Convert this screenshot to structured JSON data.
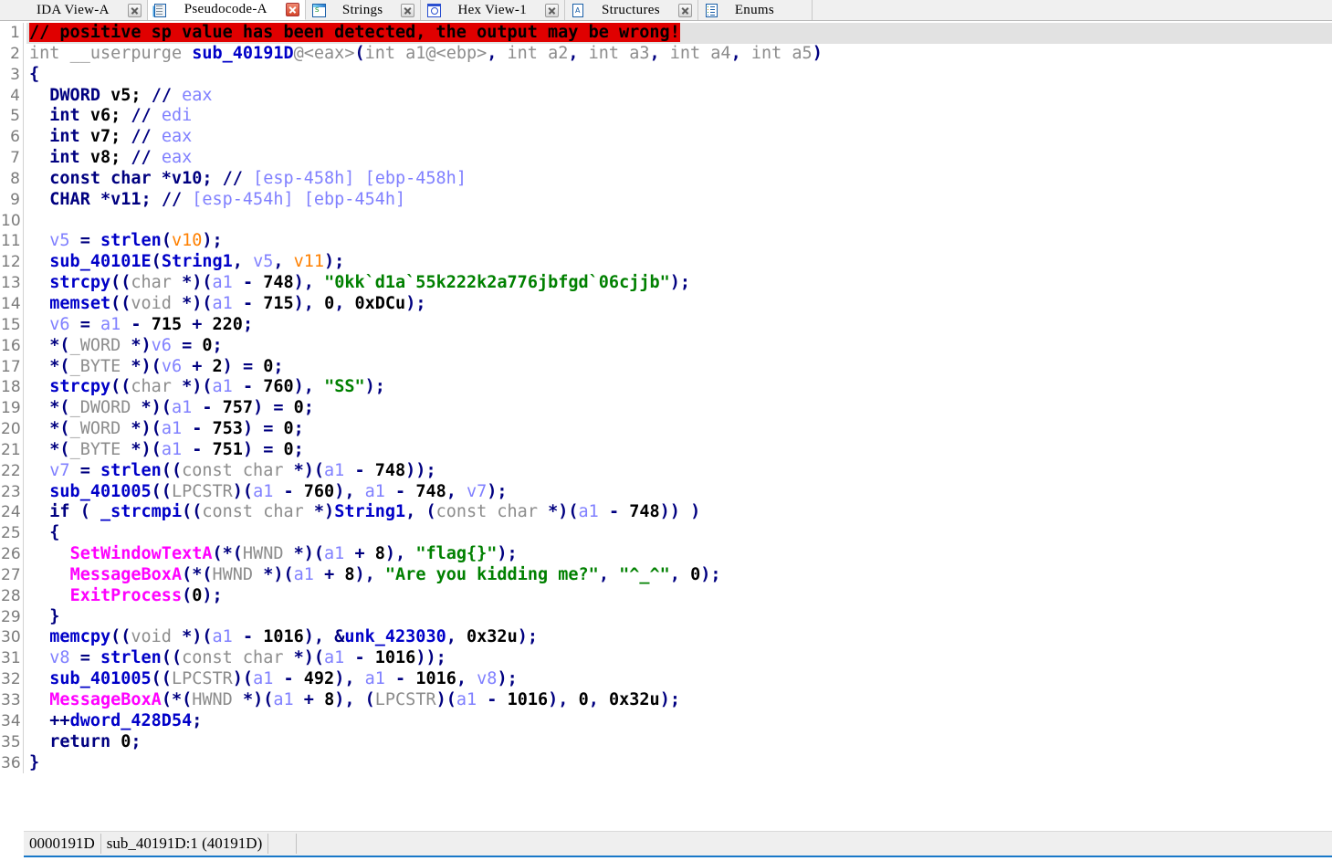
{
  "window": {
    "title": "IDA View / Pseudocode"
  },
  "tabs": [
    {
      "label": "IDA View-A",
      "icon": "ida-view-icon",
      "closable": true,
      "close_style": "gray",
      "active": false,
      "has_icon": false
    },
    {
      "label": "Pseudocode-A",
      "icon": "pseudocode-icon",
      "closable": true,
      "close_style": "red",
      "active": true,
      "has_icon": true
    },
    {
      "label": "Strings",
      "icon": "strings-icon",
      "closable": true,
      "close_style": "gray",
      "active": false,
      "has_icon": true
    },
    {
      "label": "Hex View-1",
      "icon": "hex-view-icon",
      "closable": true,
      "close_style": "gray",
      "active": false,
      "has_icon": true
    },
    {
      "label": "Structures",
      "icon": "structures-icon",
      "closable": true,
      "close_style": "gray",
      "active": false,
      "has_icon": true
    },
    {
      "label": "Enums",
      "icon": "enums-icon",
      "closable": false,
      "close_style": "gray",
      "active": false,
      "has_icon": true
    }
  ],
  "code": {
    "language": "c-pseudocode",
    "selected_line": 1,
    "lines": [
      {
        "n": 1,
        "html": "<span class=\"t-warn\">// positive sp value has been detected, the output may be wrong!</span>"
      },
      {
        "n": 2,
        "html": "<span class=\"t-type\">int</span> <span class=\"t-type\">__userpurge</span> <span class=\"t-fn\">sub_40191D</span><span class=\"t-type\">@&lt;eax&gt;</span><span class=\"t-punc\">(</span><span class=\"t-type\">int a1@&lt;ebp&gt;</span><span class=\"t-punc\">,</span><span class=\"t-type\"> int a2</span><span class=\"t-punc\">,</span><span class=\"t-type\"> int a3</span><span class=\"t-punc\">,</span><span class=\"t-type\"> int a4</span><span class=\"t-punc\">,</span><span class=\"t-type\"> int a5</span><span class=\"t-punc\">)</span>"
      },
      {
        "n": 3,
        "html": "<span class=\"t-punc\">{</span>"
      },
      {
        "n": 4,
        "html": "  <span class=\"t-kw\">DWORD</span> <span class=\"t-plain\">v5;</span> <span class=\"t-kw\">//</span> <span class=\"t-var\">eax</span>"
      },
      {
        "n": 5,
        "html": "  <span class=\"t-kw\">int</span> <span class=\"t-plain\">v6;</span> <span class=\"t-kw\">//</span> <span class=\"t-var\">edi</span>"
      },
      {
        "n": 6,
        "html": "  <span class=\"t-kw\">int</span> <span class=\"t-plain\">v7;</span> <span class=\"t-kw\">//</span> <span class=\"t-var\">eax</span>"
      },
      {
        "n": 7,
        "html": "  <span class=\"t-kw\">int</span> <span class=\"t-plain\">v8;</span> <span class=\"t-kw\">//</span> <span class=\"t-var\">eax</span>"
      },
      {
        "n": 8,
        "html": "  <span class=\"t-kw\">const char *v10;</span> <span class=\"t-kw\">//</span> <span class=\"t-var\">[esp-458h] [ebp-458h]</span>"
      },
      {
        "n": 9,
        "html": "  <span class=\"t-kw\">CHAR *v11;</span> <span class=\"t-kw\">//</span> <span class=\"t-var\">[esp-454h] [ebp-454h]</span>"
      },
      {
        "n": 10,
        "html": ""
      },
      {
        "n": 11,
        "html": "  <span class=\"t-var\">v5</span> <span class=\"t-punc\">=</span> <span class=\"t-fn\">strlen</span><span class=\"t-punc\">(</span><span class=\"t-var2\">v10</span><span class=\"t-punc\">);</span>"
      },
      {
        "n": 12,
        "html": "  <span class=\"t-fn\">sub_40101E</span><span class=\"t-punc\">(</span><span class=\"t-fn\">String1</span><span class=\"t-punc\">,</span> <span class=\"t-var\">v5</span><span class=\"t-punc\">,</span> <span class=\"t-var2\">v11</span><span class=\"t-punc\">);</span>"
      },
      {
        "n": 13,
        "html": "  <span class=\"t-fn\">strcpy</span><span class=\"t-punc\">((</span><span class=\"t-gray\">char </span><span class=\"t-punc\">*)(</span><span class=\"t-var\">a1</span> <span class=\"t-punc\">-</span> <span class=\"t-num\">748</span><span class=\"t-punc\">),</span> <span class=\"t-str\">\"0kk`d1a`55k222k2a776jbfgd`06cjjb\"</span><span class=\"t-punc\">);</span>"
      },
      {
        "n": 14,
        "html": "  <span class=\"t-fn\">memset</span><span class=\"t-punc\">((</span><span class=\"t-gray\">void </span><span class=\"t-punc\">*)(</span><span class=\"t-var\">a1</span> <span class=\"t-punc\">-</span> <span class=\"t-num\">715</span><span class=\"t-punc\">),</span> <span class=\"t-num\">0</span><span class=\"t-punc\">,</span> <span class=\"t-num\">0xDCu</span><span class=\"t-punc\">);</span>"
      },
      {
        "n": 15,
        "html": "  <span class=\"t-var\">v6</span> <span class=\"t-punc\">=</span> <span class=\"t-var\">a1</span> <span class=\"t-punc\">-</span> <span class=\"t-num\">715</span> <span class=\"t-punc\">+</span> <span class=\"t-num\">220</span><span class=\"t-punc\">;</span>"
      },
      {
        "n": 16,
        "html": "  <span class=\"t-punc\">*(</span><span class=\"t-gray\">_WORD </span><span class=\"t-punc\">*)</span><span class=\"t-var\">v6</span> <span class=\"t-punc\">=</span> <span class=\"t-num\">0</span><span class=\"t-punc\">;</span>"
      },
      {
        "n": 17,
        "html": "  <span class=\"t-punc\">*(</span><span class=\"t-gray\">_BYTE </span><span class=\"t-punc\">*)(</span><span class=\"t-var\">v6</span> <span class=\"t-punc\">+</span> <span class=\"t-num\">2</span><span class=\"t-punc\">)</span> <span class=\"t-punc\">=</span> <span class=\"t-num\">0</span><span class=\"t-punc\">;</span>"
      },
      {
        "n": 18,
        "html": "  <span class=\"t-fn\">strcpy</span><span class=\"t-punc\">((</span><span class=\"t-gray\">char </span><span class=\"t-punc\">*)(</span><span class=\"t-var\">a1</span> <span class=\"t-punc\">-</span> <span class=\"t-num\">760</span><span class=\"t-punc\">),</span> <span class=\"t-str\">\"SS\"</span><span class=\"t-punc\">);</span>"
      },
      {
        "n": 19,
        "html": "  <span class=\"t-punc\">*(</span><span class=\"t-gray\">_DWORD </span><span class=\"t-punc\">*)(</span><span class=\"t-var\">a1</span> <span class=\"t-punc\">-</span> <span class=\"t-num\">757</span><span class=\"t-punc\">)</span> <span class=\"t-punc\">=</span> <span class=\"t-num\">0</span><span class=\"t-punc\">;</span>"
      },
      {
        "n": 20,
        "html": "  <span class=\"t-punc\">*(</span><span class=\"t-gray\">_WORD </span><span class=\"t-punc\">*)(</span><span class=\"t-var\">a1</span> <span class=\"t-punc\">-</span> <span class=\"t-num\">753</span><span class=\"t-punc\">)</span> <span class=\"t-punc\">=</span> <span class=\"t-num\">0</span><span class=\"t-punc\">;</span>"
      },
      {
        "n": 21,
        "html": "  <span class=\"t-punc\">*(</span><span class=\"t-gray\">_BYTE </span><span class=\"t-punc\">*)(</span><span class=\"t-var\">a1</span> <span class=\"t-punc\">-</span> <span class=\"t-num\">751</span><span class=\"t-punc\">)</span> <span class=\"t-punc\">=</span> <span class=\"t-num\">0</span><span class=\"t-punc\">;</span>"
      },
      {
        "n": 22,
        "html": "  <span class=\"t-var\">v7</span> <span class=\"t-punc\">=</span> <span class=\"t-fn\">strlen</span><span class=\"t-punc\">((</span><span class=\"t-gray\">const char </span><span class=\"t-punc\">*)(</span><span class=\"t-var\">a1</span> <span class=\"t-punc\">-</span> <span class=\"t-num\">748</span><span class=\"t-punc\">));</span>"
      },
      {
        "n": 23,
        "html": "  <span class=\"t-fn\">sub_401005</span><span class=\"t-punc\">((</span><span class=\"t-gray\">LPCSTR</span><span class=\"t-punc\">)(</span><span class=\"t-var\">a1</span> <span class=\"t-punc\">-</span> <span class=\"t-num\">760</span><span class=\"t-punc\">),</span> <span class=\"t-var\">a1</span> <span class=\"t-punc\">-</span> <span class=\"t-num\">748</span><span class=\"t-punc\">,</span> <span class=\"t-var\">v7</span><span class=\"t-punc\">);</span>"
      },
      {
        "n": 24,
        "html": "  <span class=\"t-kw\">if</span> <span class=\"t-punc\">(</span> <span class=\"t-fn\">_strcmpi</span><span class=\"t-punc\">((</span><span class=\"t-gray\">const char </span><span class=\"t-punc\">*)</span><span class=\"t-fn\">String1</span><span class=\"t-punc\">,</span> <span class=\"t-punc\">(</span><span class=\"t-gray\">const char </span><span class=\"t-punc\">*)(</span><span class=\"t-var\">a1</span> <span class=\"t-punc\">-</span> <span class=\"t-num\">748</span><span class=\"t-punc\">))</span> <span class=\"t-punc\">)</span>"
      },
      {
        "n": 25,
        "html": "  <span class=\"t-punc\">{</span>"
      },
      {
        "n": 26,
        "html": "    <span class=\"t-api\">SetWindowTextA</span><span class=\"t-punc\">(*(</span><span class=\"t-gray\">HWND </span><span class=\"t-punc\">*)(</span><span class=\"t-var\">a1</span> <span class=\"t-punc\">+</span> <span class=\"t-num\">8</span><span class=\"t-punc\">),</span> <span class=\"t-str\">\"flag{}\"</span><span class=\"t-punc\">);</span>"
      },
      {
        "n": 27,
        "html": "    <span class=\"t-api\">MessageBoxA</span><span class=\"t-punc\">(*(</span><span class=\"t-gray\">HWND </span><span class=\"t-punc\">*)(</span><span class=\"t-var\">a1</span> <span class=\"t-punc\">+</span> <span class=\"t-num\">8</span><span class=\"t-punc\">),</span> <span class=\"t-str\">\"Are you kidding me?\"</span><span class=\"t-punc\">,</span> <span class=\"t-str\">\"^_^\"</span><span class=\"t-punc\">,</span> <span class=\"t-num\">0</span><span class=\"t-punc\">);</span>"
      },
      {
        "n": 28,
        "html": "    <span class=\"t-api\">ExitProcess</span><span class=\"t-punc\">(</span><span class=\"t-num\">0</span><span class=\"t-punc\">);</span>"
      },
      {
        "n": 29,
        "html": "  <span class=\"t-punc\">}</span>"
      },
      {
        "n": 30,
        "html": "  <span class=\"t-fn\">memcpy</span><span class=\"t-punc\">((</span><span class=\"t-gray\">void </span><span class=\"t-punc\">*)(</span><span class=\"t-var\">a1</span> <span class=\"t-punc\">-</span> <span class=\"t-num\">1016</span><span class=\"t-punc\">),</span> <span class=\"t-punc\">&amp;</span><span class=\"t-fn\">unk_423030</span><span class=\"t-punc\">,</span> <span class=\"t-num\">0x32u</span><span class=\"t-punc\">);</span>"
      },
      {
        "n": 31,
        "html": "  <span class=\"t-var\">v8</span> <span class=\"t-punc\">=</span> <span class=\"t-fn\">strlen</span><span class=\"t-punc\">((</span><span class=\"t-gray\">const char </span><span class=\"t-punc\">*)(</span><span class=\"t-var\">a1</span> <span class=\"t-punc\">-</span> <span class=\"t-num\">1016</span><span class=\"t-punc\">));</span>"
      },
      {
        "n": 32,
        "html": "  <span class=\"t-fn\">sub_401005</span><span class=\"t-punc\">((</span><span class=\"t-gray\">LPCSTR</span><span class=\"t-punc\">)(</span><span class=\"t-var\">a1</span> <span class=\"t-punc\">-</span> <span class=\"t-num\">492</span><span class=\"t-punc\">),</span> <span class=\"t-var\">a1</span> <span class=\"t-punc\">-</span> <span class=\"t-num\">1016</span><span class=\"t-punc\">,</span> <span class=\"t-var\">v8</span><span class=\"t-punc\">);</span>"
      },
      {
        "n": 33,
        "html": "  <span class=\"t-api\">MessageBoxA</span><span class=\"t-punc\">(*(</span><span class=\"t-gray\">HWND </span><span class=\"t-punc\">*)(</span><span class=\"t-var\">a1</span> <span class=\"t-punc\">+</span> <span class=\"t-num\">8</span><span class=\"t-punc\">),</span> <span class=\"t-punc\">(</span><span class=\"t-gray\">LPCSTR</span><span class=\"t-punc\">)(</span><span class=\"t-var\">a1</span> <span class=\"t-punc\">-</span> <span class=\"t-num\">1016</span><span class=\"t-punc\">),</span> <span class=\"t-num\">0</span><span class=\"t-punc\">,</span> <span class=\"t-num\">0x32u</span><span class=\"t-punc\">);</span>"
      },
      {
        "n": 34,
        "html": "  <span class=\"t-punc\">++</span><span class=\"t-fn\">dword_428D54</span><span class=\"t-punc\">;</span>"
      },
      {
        "n": 35,
        "html": "  <span class=\"t-kw\">return</span> <span class=\"t-num\">0</span><span class=\"t-punc\">;</span>"
      },
      {
        "n": 36,
        "html": "<span class=\"t-punc\">}</span>"
      }
    ],
    "plain_lines": [
      "// positive sp value has been detected, the output may be wrong!",
      "int __userpurge sub_40191D@<eax>(int a1@<ebp>, int a2, int a3, int a4, int a5)",
      "{",
      "  DWORD v5; // eax",
      "  int v6; // edi",
      "  int v7; // eax",
      "  int v8; // eax",
      "  const char *v10; // [esp-458h] [ebp-458h]",
      "  CHAR *v11; // [esp-454h] [ebp-454h]",
      "",
      "  v5 = strlen(v10);",
      "  sub_40101E(String1, v5, v11);",
      "  strcpy((char *)(a1 - 748), \"0kk`d1a`55k222k2a776jbfgd`06cjjb\");",
      "  memset((void *)(a1 - 715), 0, 0xDCu);",
      "  v6 = a1 - 715 + 220;",
      "  *(_WORD *)v6 = 0;",
      "  *(_BYTE *)(v6 + 2) = 0;",
      "  strcpy((char *)(a1 - 760), \"SS\");",
      "  *(_DWORD *)(a1 - 757) = 0;",
      "  *(_WORD *)(a1 - 753) = 0;",
      "  *(_BYTE *)(a1 - 751) = 0;",
      "  v7 = strlen((const char *)(a1 - 748));",
      "  sub_401005((LPCSTR)(a1 - 760), a1 - 748, v7);",
      "  if ( _strcmpi((const char *)String1, (const char *)(a1 - 748)) )",
      "  {",
      "    SetWindowTextA(*(HWND *)(a1 + 8), \"flag{}\");",
      "    MessageBoxA(*(HWND *)(a1 + 8), \"Are you kidding me?\", \"^_^\", 0);",
      "    ExitProcess(0);",
      "  }",
      "  memcpy((void *)(a1 - 1016), &unk_423030, 0x32u);",
      "  v8 = strlen((const char *)(a1 - 1016));",
      "  sub_401005((LPCSTR)(a1 - 492), a1 - 1016, v8);",
      "  MessageBoxA(*(HWND *)(a1 + 8), (LPCSTR)(a1 - 1016), 0, 0x32u);",
      "  ++dword_428D54;",
      "  return 0;",
      "}"
    ]
  },
  "status_bar": {
    "address": "0000191D",
    "location": "sub_40191D:1  (40191D)",
    "extra": ""
  },
  "colors": {
    "warning_background": "#e00000",
    "selected_line_background": "#e2e2e2",
    "keyword": "#000080",
    "function": "#0000c8",
    "winapi": "#ff00ff",
    "string": "#008000",
    "variable": "#8080ff",
    "variable_alt": "#ff8000",
    "type_gray": "#8c8c8c",
    "gutter_text": "#7b7b7b",
    "status_underline": "#1878c8"
  }
}
